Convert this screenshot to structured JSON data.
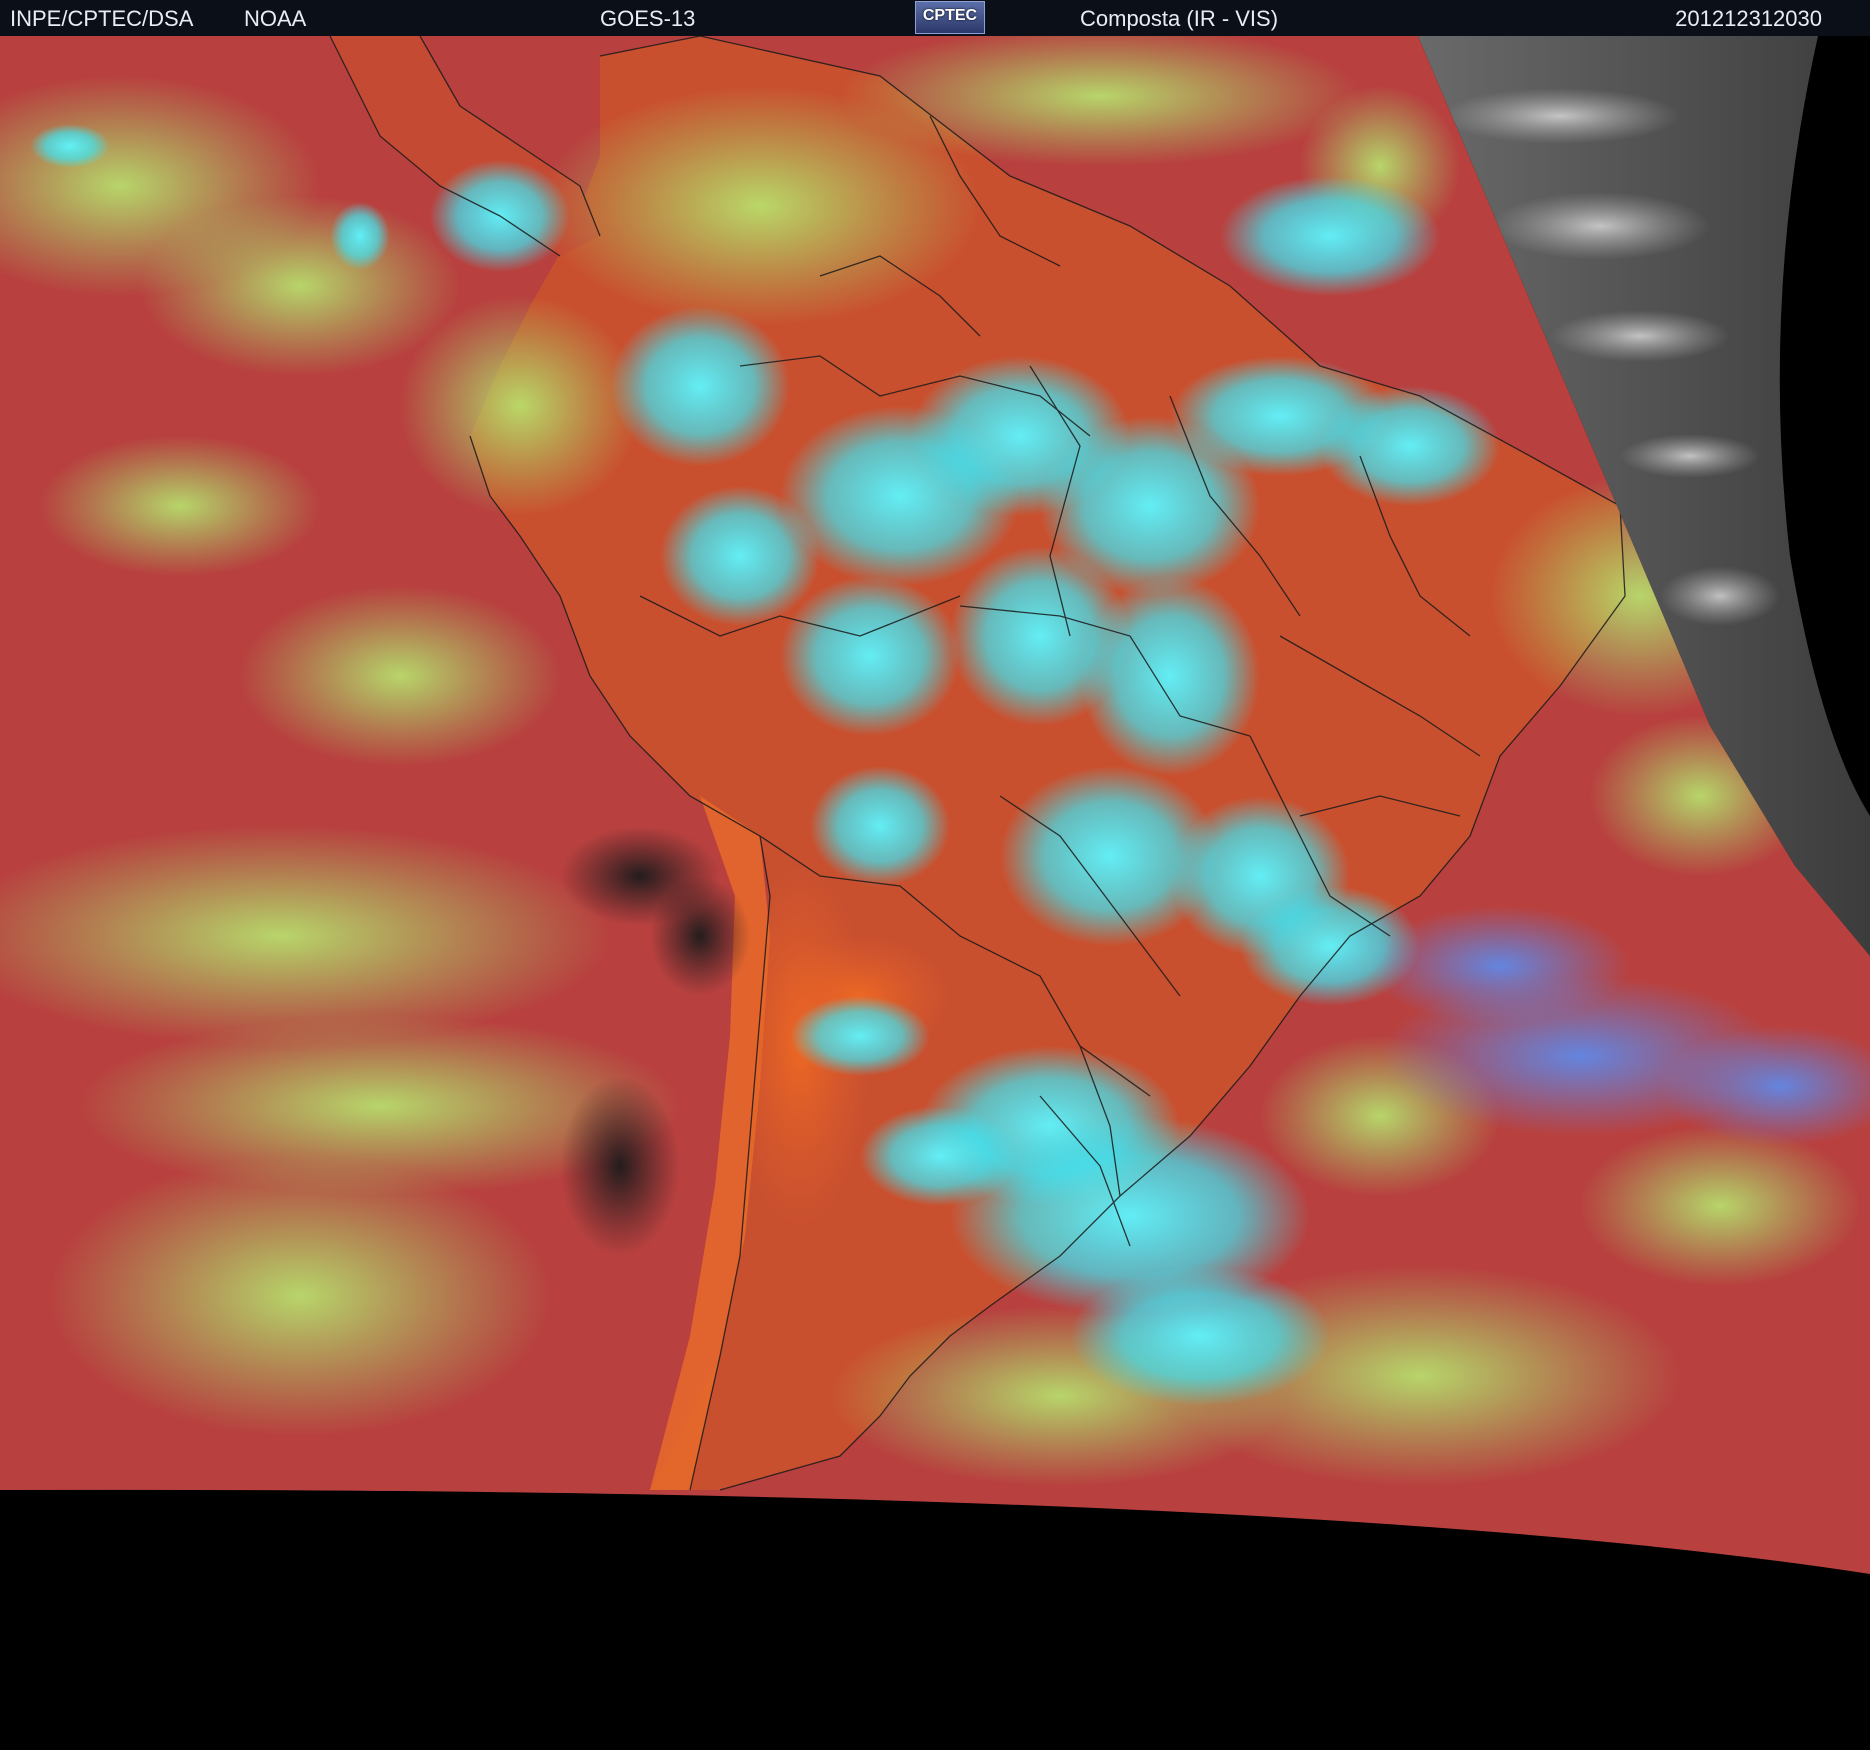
{
  "header": {
    "agency": "INPE/CPTEC/DSA",
    "partner": "NOAA",
    "satellite": "GOES-13",
    "logo_text": "CPTEC",
    "product": "Composta (IR - VIS)",
    "timestamp": "201212312030"
  },
  "colors": {
    "background": "#000000",
    "ocean_red": "#b8413f",
    "continent_orange": "#d4552e",
    "cloud_cyan": "#35e8f2",
    "cloud_green": "#a9e86a",
    "night_gray": "#5e5e5e"
  }
}
